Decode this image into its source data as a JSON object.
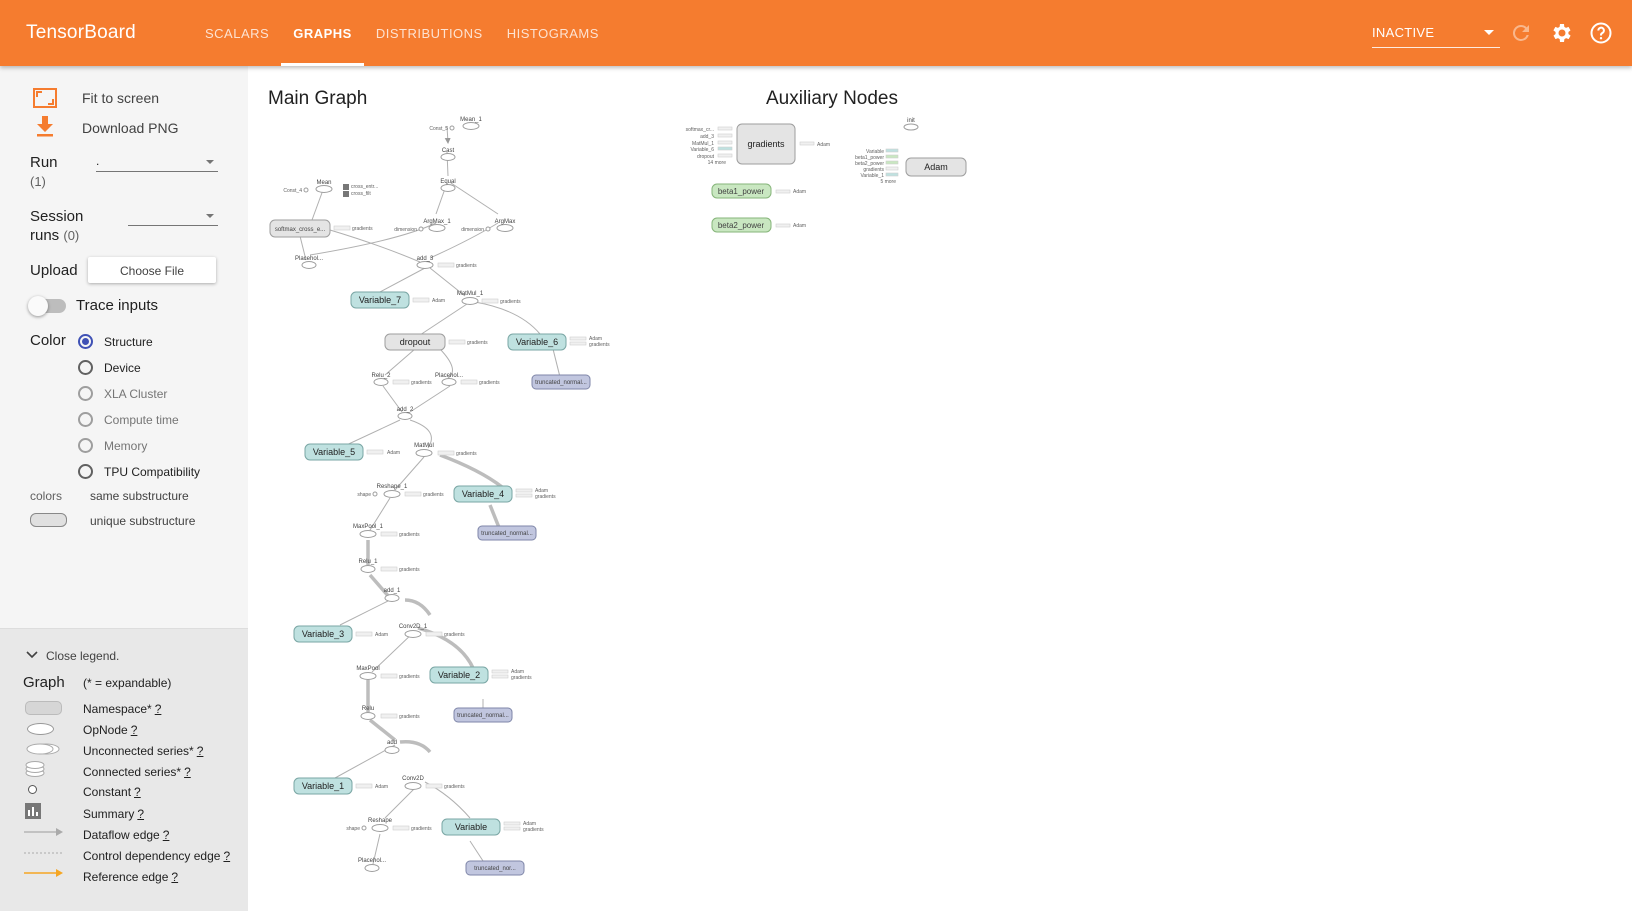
{
  "header": {
    "brand": "TensorBoard",
    "tabs": [
      {
        "label": "SCALARS"
      },
      {
        "label": "GRAPHS"
      },
      {
        "label": "DISTRIBUTIONS"
      },
      {
        "label": "HISTOGRAMS"
      }
    ],
    "active_tab": "GRAPHS",
    "status_value": "INACTIVE",
    "icons": [
      "refresh-icon",
      "settings-gear-icon",
      "help-icon"
    ],
    "brand_color": "#f57c2f"
  },
  "sidebar": {
    "fit_to_screen": "Fit to screen",
    "download_png": "Download PNG",
    "run_label": "Run",
    "run_count": "(1)",
    "run_value": ".",
    "session_label_1": "Session",
    "session_label_2": "runs",
    "session_count": "(0)",
    "upload_label": "Upload",
    "choose_file": "Choose File",
    "trace_inputs": "Trace inputs",
    "color_label": "Color",
    "color_options": [
      {
        "label": "Structure",
        "checked": true
      },
      {
        "label": "Device",
        "checked": false
      },
      {
        "label": "XLA Cluster",
        "checked": false
      },
      {
        "label": "Compute time",
        "checked": false
      },
      {
        "label": "Memory",
        "checked": false
      },
      {
        "label": "TPU Compatibility",
        "checked": false
      }
    ],
    "colors_label": "colors",
    "same_substructure": "same substructure",
    "unique_substructure": "unique substructure"
  },
  "legend": {
    "close_label": "Close legend.",
    "graph_label": "Graph",
    "expandable_note": "(* = expandable)",
    "items": [
      {
        "label": "Namespace*",
        "help": "?"
      },
      {
        "label": "OpNode",
        "help": "?"
      },
      {
        "label": "Unconnected series*",
        "help": "?"
      },
      {
        "label": "Connected series*",
        "help": "?"
      },
      {
        "label": "Constant",
        "help": "?"
      },
      {
        "label": "Summary",
        "help": "?"
      },
      {
        "label": "Dataflow edge",
        "help": "?"
      },
      {
        "label": "Control dependency edge",
        "help": "?"
      },
      {
        "label": "Reference edge",
        "help": "?"
      }
    ]
  },
  "main_graph": {
    "title": "Main Graph",
    "nodes": {
      "mean1": "Mean_1",
      "const5": "Const_5",
      "cast": "Cast",
      "equal": "Equal",
      "mean": "Mean",
      "const4": "Const_4",
      "cross_entr": "cross_entr...",
      "cross_filt": "cross_filt",
      "argmax1": "ArgMax_1",
      "argmax": "ArgMax",
      "dimension": "dimension",
      "softmax": "softmax_cross_e...",
      "gradients": "gradients",
      "placehol": "Placehol...",
      "add3": "add_3",
      "variable7": "Variable_7",
      "adam": "Adam",
      "matmul1": "MatMul_1",
      "dropout": "dropout",
      "variable6": "Variable_6",
      "relu2": "Relu_2",
      "truncated_normal": "truncated_normal...",
      "add2": "add_2",
      "variable5": "Variable_5",
      "matmul": "MatMul",
      "reshape1": "Reshape_1",
      "shape": "shape",
      "variable4": "Variable_4",
      "maxpool1": "MaxPool_1",
      "relu1": "Relu_1",
      "add1": "add_1",
      "variable3": "Variable_3",
      "conv2d1": "Conv2D_1",
      "maxpool": "MaxPool",
      "variable2": "Variable_2",
      "relu": "Relu",
      "add": "add",
      "variable1": "Variable_1",
      "conv2d": "Conv2D",
      "reshape": "Reshape",
      "variable": "Variable",
      "truncated_not": "truncated_nor...",
      "placehol2": "Placehol..."
    }
  },
  "aux_nodes": {
    "title": "Auxiliary Nodes",
    "gradients": "gradients",
    "adam": "Adam",
    "init": "init",
    "beta1_power": "beta1_power",
    "beta2_power": "beta2_power",
    "grad_inputs": [
      "softmax_cr...",
      "add_3",
      "MatMul_1",
      "Variable_6",
      "dropout",
      "14 more"
    ],
    "adam_inputs": [
      "Variable",
      "beta1_power",
      "beta2_power",
      "gradients",
      "Variable_1",
      "5 more"
    ]
  }
}
